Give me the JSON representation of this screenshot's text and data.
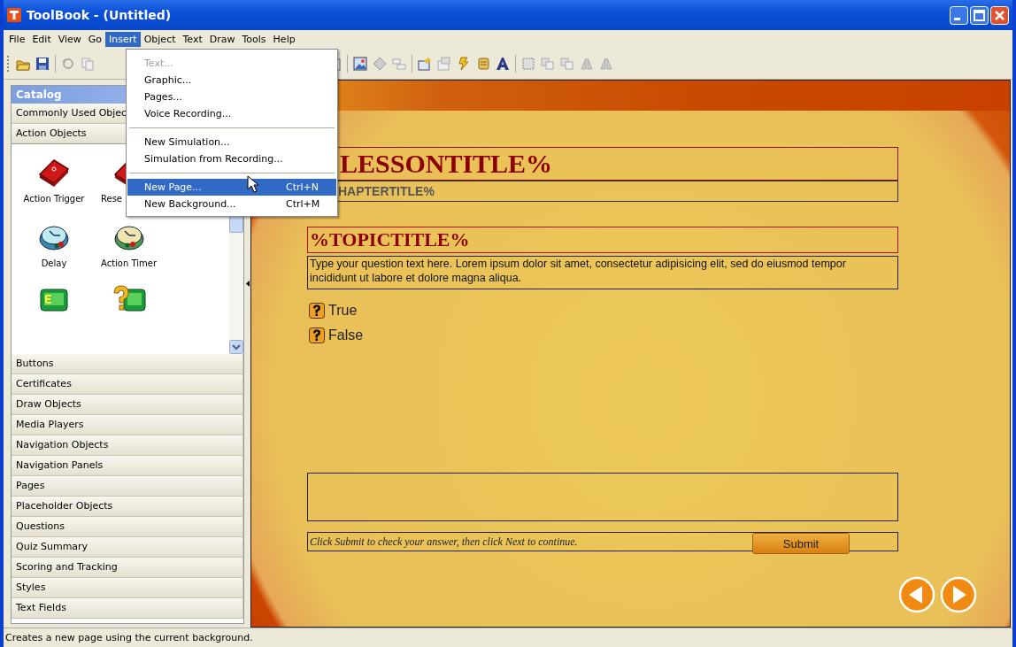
{
  "window": {
    "title": "ToolBook - (Untitled)"
  },
  "menu_bar": [
    {
      "label": "File",
      "selected": false
    },
    {
      "label": "Edit",
      "selected": false
    },
    {
      "label": "View",
      "selected": false
    },
    {
      "label": "Go",
      "selected": false
    },
    {
      "label": "Insert",
      "selected": true
    },
    {
      "label": "Object",
      "selected": false
    },
    {
      "label": "Text",
      "selected": false
    },
    {
      "label": "Draw",
      "selected": false
    },
    {
      "label": "Tools",
      "selected": false
    },
    {
      "label": "Help",
      "selected": false
    }
  ],
  "insert_menu": [
    {
      "kind": "item",
      "label": "Text...",
      "disabled": true,
      "selected": false
    },
    {
      "kind": "item",
      "label": "Graphic...",
      "disabled": false,
      "selected": false
    },
    {
      "kind": "item",
      "label": "Pages...",
      "disabled": false,
      "selected": false
    },
    {
      "kind": "item",
      "label": "Voice Recording...",
      "disabled": false,
      "selected": false
    },
    {
      "kind": "separator"
    },
    {
      "kind": "item",
      "label": "New Simulation...",
      "disabled": false,
      "selected": false
    },
    {
      "kind": "item",
      "label": "Simulation from Recording...",
      "disabled": false,
      "selected": false
    },
    {
      "kind": "separator"
    },
    {
      "kind": "item",
      "label": "New Page...",
      "shortcut": "Ctrl+N",
      "disabled": false,
      "selected": true
    },
    {
      "kind": "item",
      "label": "New Background...",
      "shortcut": "Ctrl+M",
      "disabled": false,
      "selected": false
    }
  ],
  "catalog": {
    "title": "Catalog",
    "sections": [
      {
        "label": "Commonly Used Objec",
        "expanded": false
      },
      {
        "label": "Action Objects",
        "expanded": true,
        "items": [
          {
            "kind": "trigger",
            "label": "Action Trigger"
          },
          {
            "kind": "reset",
            "label": "Rese"
          },
          {
            "kind": "delay",
            "label": "Delay"
          },
          {
            "kind": "timer",
            "label": "Action Timer"
          },
          {
            "kind": "exit"
          },
          {
            "kind": "exit-question"
          }
        ]
      },
      {
        "label": "Buttons",
        "expanded": false
      },
      {
        "label": "Certificates",
        "expanded": false
      },
      {
        "label": "Draw Objects",
        "expanded": false
      },
      {
        "label": "Media Players",
        "expanded": false
      },
      {
        "label": "Navigation Objects",
        "expanded": false
      },
      {
        "label": "Navigation Panels",
        "expanded": false
      },
      {
        "label": "Pages",
        "expanded": false
      },
      {
        "label": "Placeholder Objects",
        "expanded": false
      },
      {
        "label": "Questions",
        "expanded": false
      },
      {
        "label": "Quiz Summary",
        "expanded": false
      },
      {
        "label": "Scoring and Tracking",
        "expanded": false
      },
      {
        "label": "Styles",
        "expanded": false
      },
      {
        "label": "Text Fields",
        "expanded": false
      }
    ]
  },
  "slide": {
    "lesson_title": "LESSONTITLE%",
    "chapter_title": "HAPTERTITLE%",
    "topic_title": "%TOPICTITLE%",
    "question": "Type your question text here. Lorem ipsum dolor sit amet, consectetur adipisicing elit, sed do eiusmod tempor incididunt ut labore et dolore magna aliqua.",
    "choices": [
      {
        "label": "True"
      },
      {
        "label": "False"
      }
    ],
    "instructions": "Click Submit to check your answer, then click Next to continue.",
    "submit_button": "Submit"
  },
  "status_bar": "Creates a new page using the current background."
}
